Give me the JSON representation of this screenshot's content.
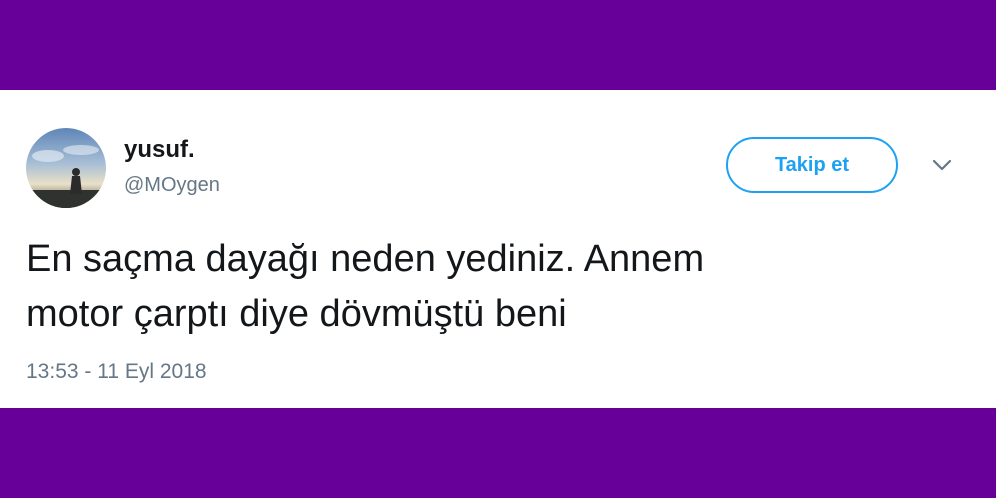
{
  "tweet": {
    "user": {
      "display_name": "yusuf.",
      "handle": "@MOygen",
      "avatar_icon": "profile-photo-silhouette-sky"
    },
    "follow_label": "Takip et",
    "menu_icon": "chevron-down-icon",
    "text_line1": "En saçma dayağı neden yediniz. Annem",
    "text_line2": "motor çarptı diye dövmüştü beni",
    "timestamp": "13:53 - 11 Eyl 2018"
  },
  "colors": {
    "background": "#660099",
    "card": "#ffffff",
    "accent": "#1da1f2",
    "text": "#14171a",
    "muted": "#657786"
  }
}
